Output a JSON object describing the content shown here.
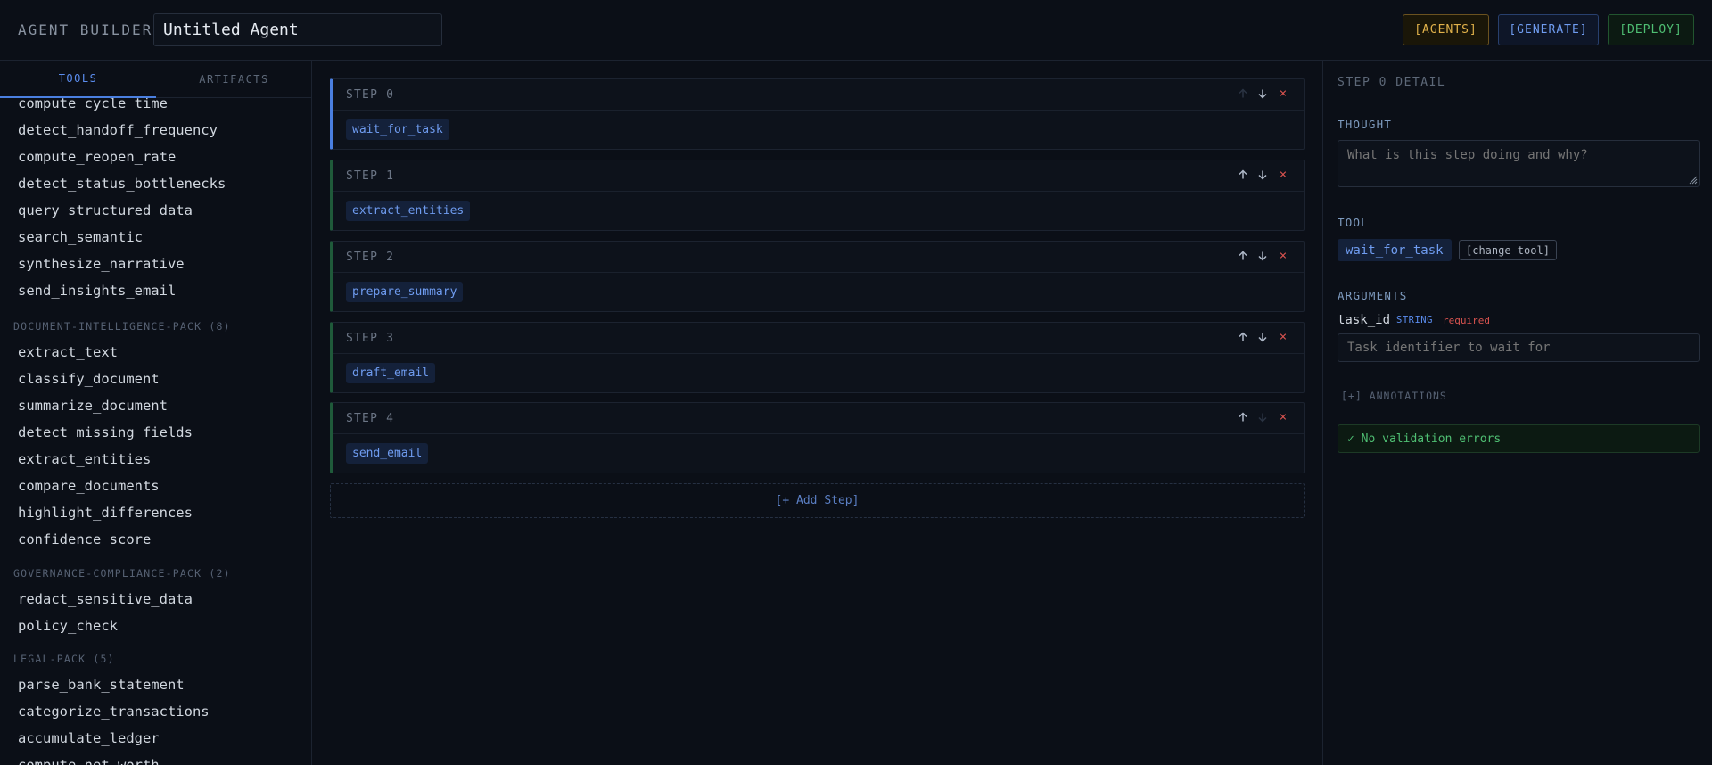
{
  "header": {
    "app_title": "AGENT BUILDER",
    "agent_name": "Untitled Agent",
    "buttons": {
      "agents": "[AGENTS]",
      "generate": "[GENERATE]",
      "deploy": "[DEPLOY]"
    }
  },
  "sidebar": {
    "tabs": {
      "tools": "TOOLS",
      "artifacts": "ARTIFACTS",
      "active": "TOOLS"
    },
    "items": [
      "compute_cycle_time",
      "detect_handoff_frequency",
      "compute_reopen_rate",
      "detect_status_bottlenecks",
      "query_structured_data",
      "search_semantic",
      "synthesize_narrative",
      "send_insights_email"
    ],
    "groups": [
      {
        "name": "DOCUMENT-INTELLIGENCE-PACK (8)",
        "tools": [
          "extract_text",
          "classify_document",
          "summarize_document",
          "detect_missing_fields",
          "extract_entities",
          "compare_documents",
          "highlight_differences",
          "confidence_score"
        ]
      },
      {
        "name": "GOVERNANCE-COMPLIANCE-PACK (2)",
        "tools": [
          "redact_sensitive_data",
          "policy_check"
        ]
      },
      {
        "name": "LEGAL-PACK (5)",
        "tools": [
          "parse_bank_statement",
          "categorize_transactions",
          "accumulate_ledger",
          "compute_net_worth"
        ]
      }
    ]
  },
  "steps": [
    {
      "label": "STEP 0",
      "tool": "wait_for_task"
    },
    {
      "label": "STEP 1",
      "tool": "extract_entities"
    },
    {
      "label": "STEP 2",
      "tool": "prepare_summary"
    },
    {
      "label": "STEP 3",
      "tool": "draft_email"
    },
    {
      "label": "STEP 4",
      "tool": "send_email"
    }
  ],
  "selected_step": 0,
  "add_step_label": "[+ Add Step]",
  "detail": {
    "title": "STEP 0 DETAIL",
    "thought_label": "THOUGHT",
    "thought_placeholder": "What is this step doing and why?",
    "tool_label": "TOOL",
    "tool_name": "wait_for_task",
    "change_tool": "[change tool]",
    "arguments_label": "ARGUMENTS",
    "argument": {
      "name": "task_id",
      "type": "STRING",
      "required": "required",
      "placeholder": "Task identifier to wait for"
    },
    "annotations": "[+] ANNOTATIONS",
    "validation": "✓ No validation errors"
  },
  "colors": {
    "accent": "#4a7fe0",
    "agents": "#e0b14a",
    "deploy": "#4fbf73",
    "danger": "#d9534f"
  }
}
